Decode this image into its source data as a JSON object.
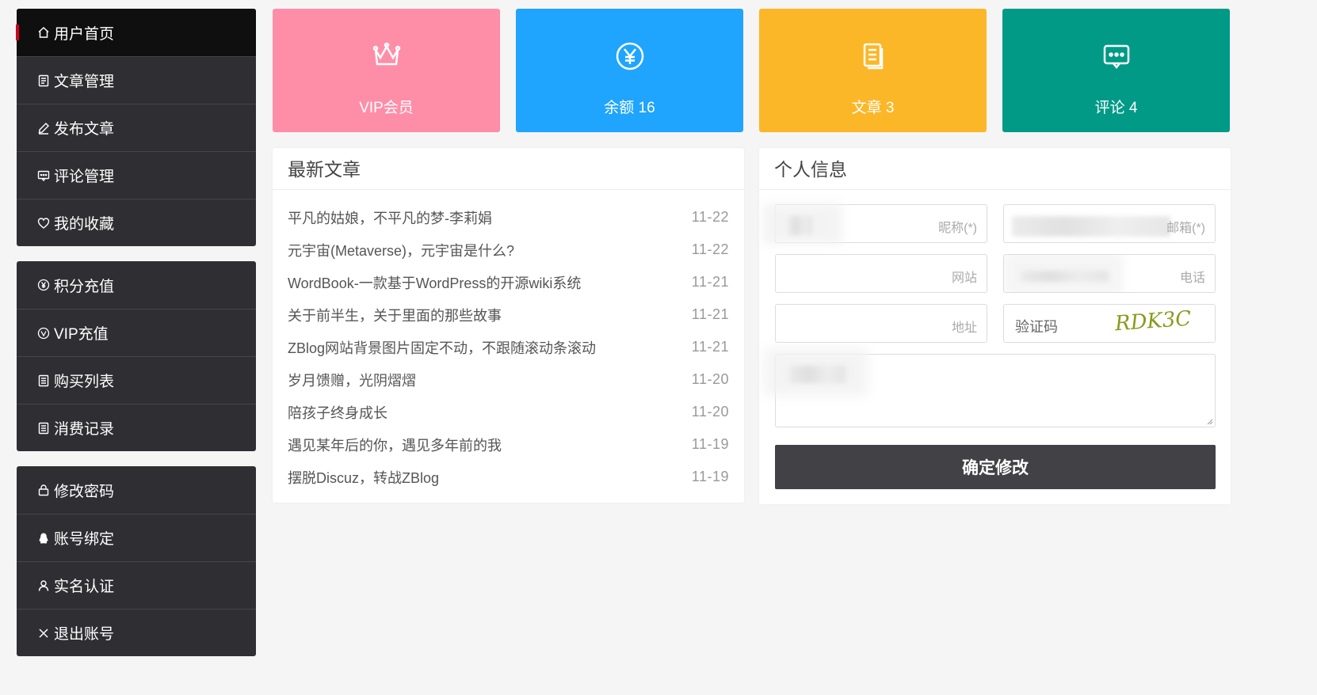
{
  "sidebar": {
    "groups": [
      [
        {
          "label": "用户首页",
          "icon": "home-icon"
        },
        {
          "label": "文章管理",
          "icon": "document-icon"
        },
        {
          "label": "发布文章",
          "icon": "pen-icon"
        },
        {
          "label": "评论管理",
          "icon": "comment-icon"
        },
        {
          "label": "我的收藏",
          "icon": "heart-icon"
        }
      ],
      [
        {
          "label": "积分充值",
          "icon": "yen-circle-icon"
        },
        {
          "label": "VIP充值",
          "icon": "vip-circle-icon"
        },
        {
          "label": "购买列表",
          "icon": "list-icon"
        },
        {
          "label": "消费记录",
          "icon": "list-icon"
        }
      ],
      [
        {
          "label": "修改密码",
          "icon": "lock-icon"
        },
        {
          "label": "账号绑定",
          "icon": "qq-icon"
        },
        {
          "label": "实名认证",
          "icon": "user-icon"
        },
        {
          "label": "退出账号",
          "icon": "close-icon"
        }
      ]
    ]
  },
  "stats": [
    {
      "label": "VIP会员",
      "icon": "crown-icon",
      "color": "#fe8ea8"
    },
    {
      "label": "余额 16",
      "icon": "yen-icon",
      "color": "#1fa5fd"
    },
    {
      "label": "文章 3",
      "icon": "document-icon",
      "color": "#fbb728"
    },
    {
      "label": "评论 4",
      "icon": "comment-icon",
      "color": "#009a87"
    }
  ],
  "latest": {
    "title": "最新文章",
    "articles": [
      {
        "title": "平凡的姑娘，不平凡的梦-李莉娟",
        "date": "11-22"
      },
      {
        "title": "元宇宙(Metaverse)，元宇宙是什么?",
        "date": "11-22"
      },
      {
        "title": "WordBook-一款基于WordPress的开源wiki系统",
        "date": "11-21"
      },
      {
        "title": "关于前半生，关于里面的那些故事",
        "date": "11-21"
      },
      {
        "title": "ZBlog网站背景图片固定不动，不跟随滚动条滚动",
        "date": "11-21"
      },
      {
        "title": "岁月馈赠，光阴熠熠",
        "date": "11-20"
      },
      {
        "title": "陪孩子终身成长",
        "date": "11-20"
      },
      {
        "title": "遇见某年后的你，遇见多年前的我",
        "date": "11-19"
      },
      {
        "title": "摆脱Discuz，转战ZBlog",
        "date": "11-19"
      }
    ]
  },
  "profile": {
    "title": "个人信息",
    "nickname_label": "昵称(*)",
    "email_label": "邮箱(*)",
    "website_label": "网站",
    "phone_label": "电话",
    "address_label": "地址",
    "captcha_placeholder": "验证码",
    "captcha_image_text": "RDK3C",
    "submit_label": "确定修改"
  }
}
